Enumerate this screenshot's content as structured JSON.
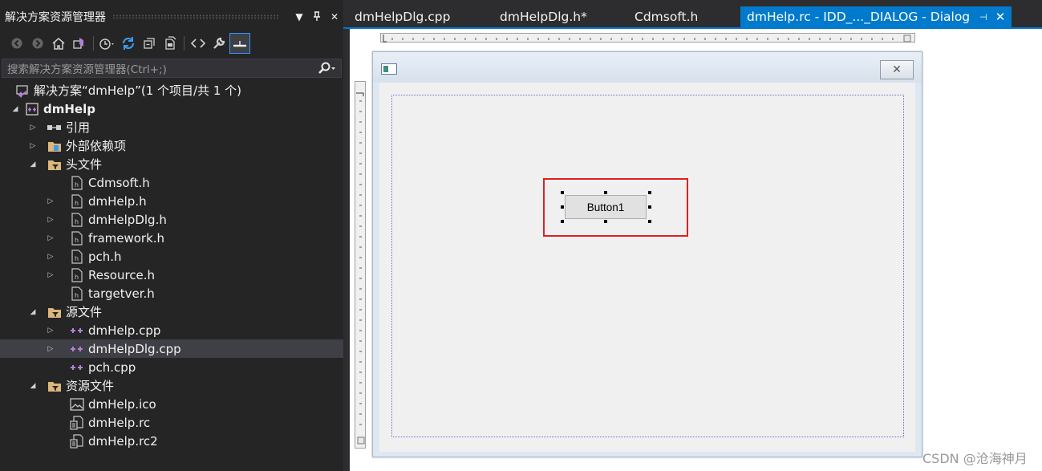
{
  "solution_explorer": {
    "title": "解决方案资源管理器",
    "controls": {
      "dropdown": "▼",
      "pin": "⊓",
      "close": "✕"
    },
    "search_placeholder": "搜索解决方案资源管理器(Ctrl+;)",
    "toolbar_icons": [
      "back-icon",
      "forward-icon",
      "home-icon",
      "switch-views-icon",
      "pending-changes-icon",
      "sync-icon",
      "collapse-all-icon",
      "show-all-files-icon",
      "view-code-icon",
      "properties-icon",
      "preview-selected-icon"
    ],
    "tree": {
      "solution": "解决方案“dmHelp”(1 个项目/共 1 个)",
      "project": "dmHelp",
      "references": "引用",
      "external_dependencies": "外部依赖项",
      "header_files": "头文件",
      "header_items": [
        "Cdmsoft.h",
        "dmHelp.h",
        "dmHelpDlg.h",
        "framework.h",
        "pch.h",
        "Resource.h",
        "targetver.h"
      ],
      "source_files": "源文件",
      "source_items": [
        "dmHelp.cpp",
        "dmHelpDlg.cpp",
        "pch.cpp"
      ],
      "resource_files": "资源文件",
      "resource_items": [
        "dmHelp.ico",
        "dmHelp.rc",
        "dmHelp.rc2"
      ]
    }
  },
  "tabs": [
    {
      "label": "dmHelpDlg.cpp"
    },
    {
      "label": "dmHelpDlg.h*"
    },
    {
      "label": "Cdmsoft.h"
    },
    {
      "label": "dmHelp.rc - IDD_..._DIALOG - Dialog",
      "active": true
    }
  ],
  "tab_controls": {
    "pin": "⊣",
    "close": "✕"
  },
  "designer": {
    "button_label": "Button1",
    "close_glyph": "✕"
  },
  "watermark": "CSDN @沧海神月",
  "colors": {
    "accent": "#007acc",
    "highlight": "#e02020"
  }
}
